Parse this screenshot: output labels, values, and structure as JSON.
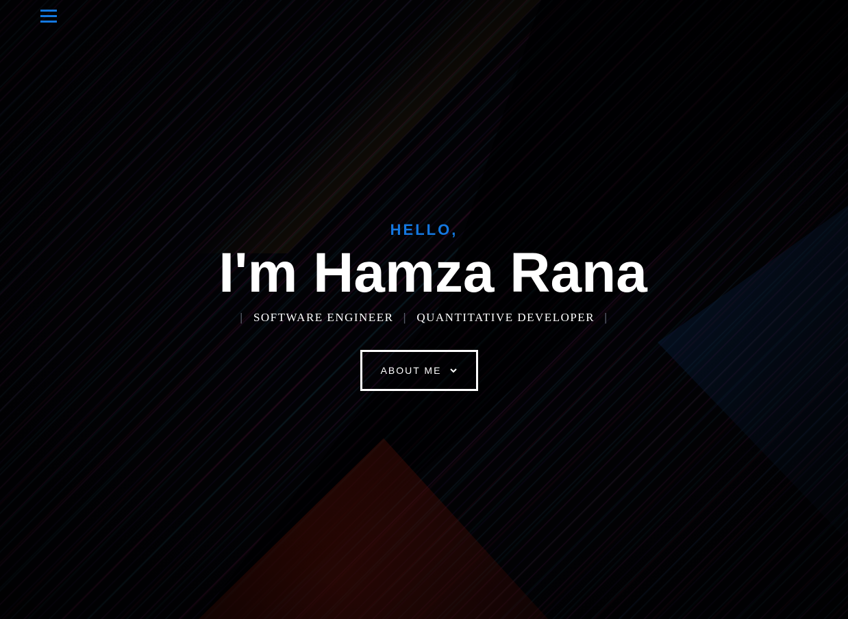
{
  "nav": {
    "menu_icon": "hamburger-icon",
    "accent_color": "#1478e0"
  },
  "hero": {
    "greeting": "HELLO,",
    "name": "I'm Hamza Rana",
    "roles": [
      "SOFTWARE ENGINEER",
      "QUANTITATIVE DEVELOPER"
    ],
    "separator": "|",
    "cta_label": "ABOUT ME",
    "cta_icon": "chevron-down-icon"
  }
}
